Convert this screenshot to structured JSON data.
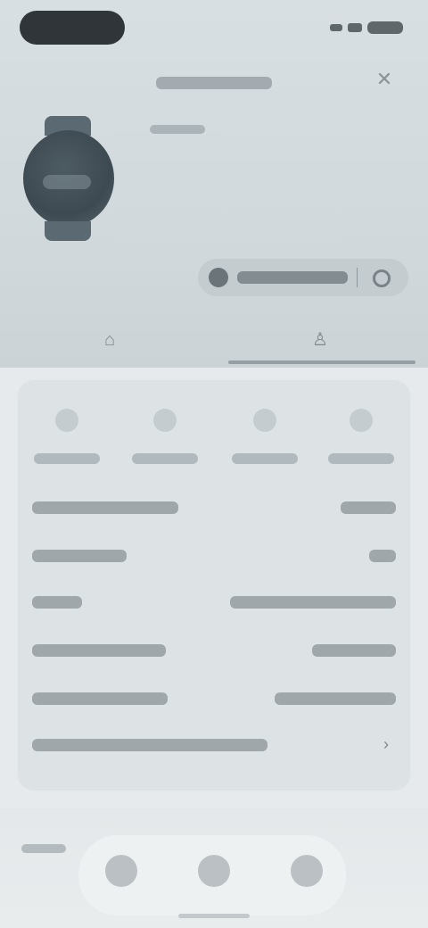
{
  "header": {
    "device_name": "",
    "device_subtitle": "",
    "sync_button_label": "",
    "close_icon": "close-icon",
    "more_icon": "more-icon"
  },
  "tabs": [
    {
      "icon": "activity-icon"
    },
    {
      "icon": "settings-icon"
    }
  ],
  "stats": [
    {
      "icon": "steps-icon",
      "value": ""
    },
    {
      "icon": "heart-icon",
      "value": ""
    },
    {
      "icon": "sleep-icon",
      "value": ""
    },
    {
      "icon": "battery-icon",
      "value": ""
    }
  ],
  "rows": [
    {
      "label": "",
      "value": ""
    },
    {
      "label": "",
      "value": ""
    },
    {
      "label": "",
      "value": ""
    },
    {
      "label": "",
      "value": ""
    },
    {
      "label": "",
      "value": ""
    },
    {
      "label": "",
      "value": ""
    }
  ],
  "bottom_nav": {
    "label": "",
    "items": [
      {
        "icon": "home-icon"
      },
      {
        "icon": "devices-icon"
      },
      {
        "icon": "profile-icon"
      }
    ]
  },
  "colors": {
    "accent": "#2f3538",
    "surface": "#dde3e5",
    "background": "#e6eaec"
  }
}
